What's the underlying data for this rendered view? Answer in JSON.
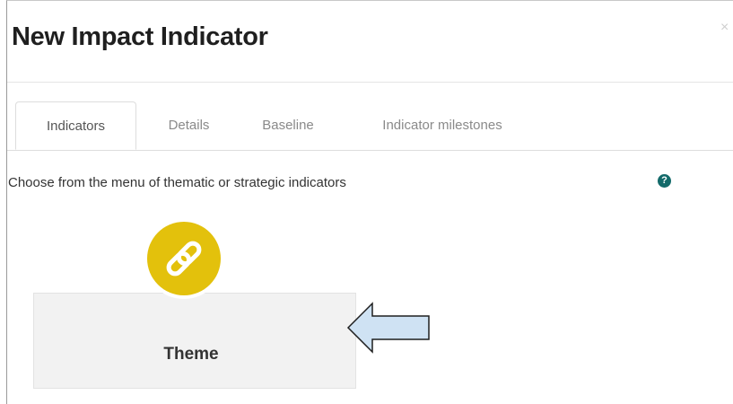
{
  "modal": {
    "title": "New Impact Indicator",
    "close_symbol": "×"
  },
  "tabs": [
    {
      "label": "Indicators",
      "active": true
    },
    {
      "label": "Details",
      "active": false
    },
    {
      "label": "Baseline",
      "active": false
    },
    {
      "label": "Indicator milestones",
      "active": false
    }
  ],
  "content": {
    "instruction": "Choose from the menu of thematic or strategic indicators",
    "help_symbol": "?"
  },
  "theme_card": {
    "label": "Theme",
    "icon": "link-icon",
    "badge_color": "#e3c10c"
  },
  "annotation": {
    "icon": "left-arrow-icon",
    "fill_color": "#cfe2f3"
  }
}
